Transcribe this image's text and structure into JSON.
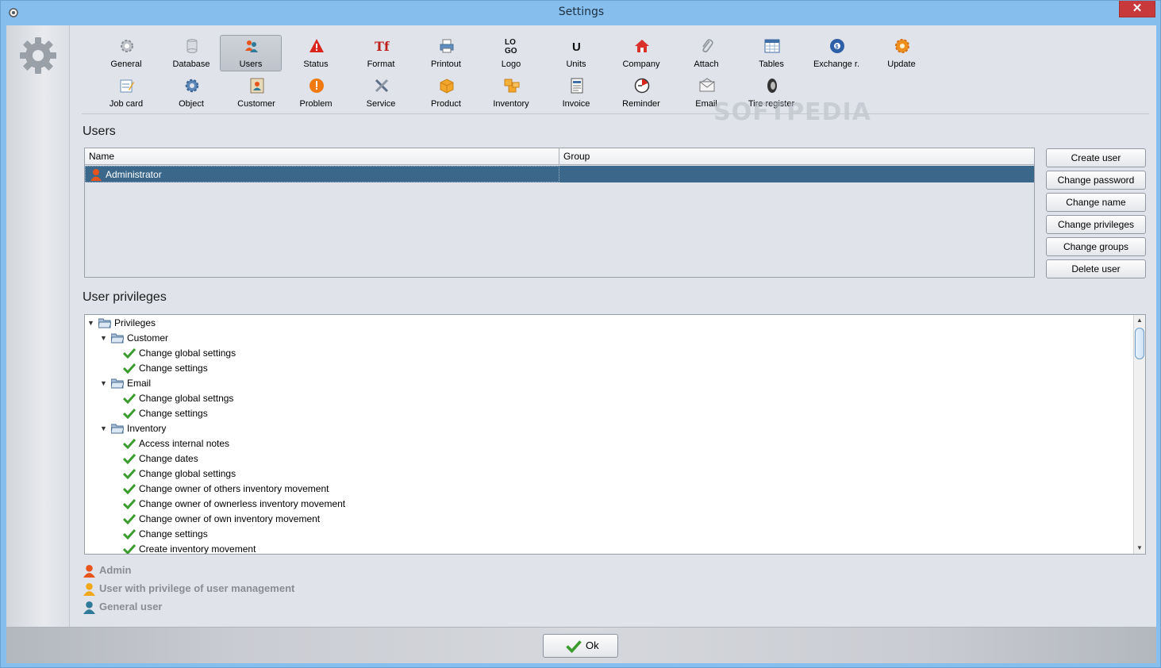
{
  "window": {
    "title": "Settings",
    "close_symbol": "✕"
  },
  "toolbar": {
    "row1": [
      {
        "label": "General",
        "icon": "gear-icon"
      },
      {
        "label": "Database",
        "icon": "database-icon"
      },
      {
        "label": "Users",
        "icon": "users-icon",
        "active": true
      },
      {
        "label": "Status",
        "icon": "warning-icon"
      },
      {
        "label": "Format",
        "icon": "format-icon"
      },
      {
        "label": "Printout",
        "icon": "printer-icon"
      },
      {
        "label": "Logo",
        "icon": "logo-icon"
      },
      {
        "label": "Units",
        "icon": "units-icon"
      },
      {
        "label": "Company",
        "icon": "house-icon"
      },
      {
        "label": "Attach",
        "icon": "paperclip-icon"
      },
      {
        "label": "Tables",
        "icon": "table-icon"
      },
      {
        "label": "Exchange r.",
        "icon": "exchange-icon"
      },
      {
        "label": "Update",
        "icon": "update-icon"
      }
    ],
    "row2": [
      {
        "label": "Job card",
        "icon": "jobcard-icon"
      },
      {
        "label": "Object",
        "icon": "cog-icon"
      },
      {
        "label": "Customer",
        "icon": "customer-icon"
      },
      {
        "label": "Problem",
        "icon": "problem-icon"
      },
      {
        "label": "Service",
        "icon": "tools-icon"
      },
      {
        "label": "Product",
        "icon": "box-icon"
      },
      {
        "label": "Inventory",
        "icon": "boxes-icon"
      },
      {
        "label": "Invoice",
        "icon": "invoice-icon"
      },
      {
        "label": "Reminder",
        "icon": "clock-icon"
      },
      {
        "label": "Email",
        "icon": "envelope-icon"
      },
      {
        "label": "Tire register",
        "icon": "tire-icon"
      }
    ],
    "logo_text_top": "LO",
    "logo_text_bottom": "GO",
    "units_text": "U"
  },
  "watermark": "SOFTPEDIA",
  "users_section": {
    "title": "Users",
    "columns": [
      "Name",
      "Group"
    ],
    "rows": [
      {
        "name": "Administrator",
        "group": ""
      }
    ]
  },
  "user_buttons": [
    "Create user",
    "Change password",
    "Change name",
    "Change privileges",
    "Change groups",
    "Delete user"
  ],
  "privileges_section": {
    "title": "User privileges",
    "root": "Privileges",
    "groups": [
      {
        "name": "Customer",
        "items": [
          "Change global settings",
          "Change settings"
        ]
      },
      {
        "name": "Email",
        "items": [
          "Change global settngs",
          "Change settings"
        ]
      },
      {
        "name": "Inventory",
        "items": [
          "Access internal notes",
          "Change dates",
          "Change global settings",
          "Change owner of others inventory movement",
          "Change owner of ownerless inventory movement",
          "Change owner of own inventory movement",
          "Change settings",
          "Create inventory movement"
        ]
      }
    ]
  },
  "legend": [
    {
      "label": "Admin",
      "color": "#e8541c"
    },
    {
      "label": "User with privilege of user management",
      "color": "#f0a818"
    },
    {
      "label": "General user",
      "color": "#2f7a98"
    }
  ],
  "footer": {
    "ok_label": "Ok"
  }
}
